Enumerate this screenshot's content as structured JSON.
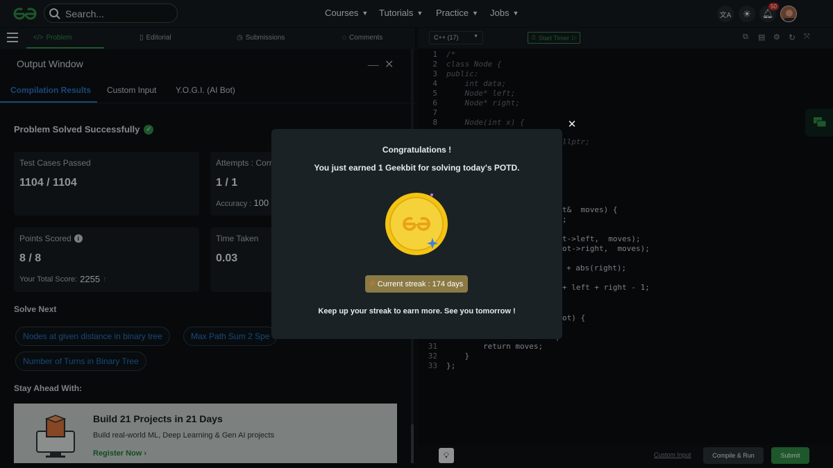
{
  "header": {
    "search_placeholder": "Search...",
    "nav": [
      "Courses",
      "Tutorials",
      "Practice",
      "Jobs"
    ],
    "notification_count": "50"
  },
  "tabs": {
    "problem": "Problem",
    "editorial": "Editorial",
    "submissions": "Submissions",
    "comments": "Comments"
  },
  "output": {
    "title": "Output Window",
    "minimize": "__",
    "tabs": [
      "Compilation Results",
      "Custom Input",
      "Y.O.G.I. (AI Bot)"
    ],
    "solved_message": "Problem Solved Successfully",
    "test_cases_label": "Test Cases Passed",
    "test_cases_value": "1104 / 1104",
    "attempts_label": "Attempts : Corr",
    "attempts_value": "1 / 1",
    "accuracy_label": "Accuracy :",
    "accuracy_value": "100",
    "points_label": "Points Scored",
    "points_value": "8 / 8",
    "total_score_label": "Your Total Score:",
    "total_score_value": "2255",
    "time_label": "Time Taken",
    "time_value": "0.03",
    "solve_next_heading": "Solve Next",
    "solve_next": [
      "Nodes at given distance in binary tree",
      "Max Path Sum 2 Spe",
      "Number of Turns in Binary Tree"
    ],
    "stay_ahead_heading": "Stay Ahead With:",
    "promo_title": "Build 21 Projects in 21 Days",
    "promo_desc": "Build real-world ML, Deep Learning & Gen AI projects",
    "promo_cta": "Register Now"
  },
  "editor": {
    "language": "C++ (17)",
    "timer_label": "Start Timer",
    "lines_top": [
      {
        "n": "1",
        "text": "/*"
      },
      {
        "n": "2",
        "text": "class Node {"
      },
      {
        "n": "3",
        "text": "public:"
      },
      {
        "n": "4",
        "text": "    int data;"
      },
      {
        "n": "5",
        "text": "    Node* left;"
      },
      {
        "n": "6",
        "text": "    Node* right;"
      },
      {
        "n": "7",
        "text": ""
      },
      {
        "n": "8",
        "text": "    Node(int x) {"
      }
    ],
    "partial_lines": [
      "llptr;",
      "t&  moves) {",
      ";",
      "t->left,  moves);",
      "ot->right,  moves);",
      "+ abs(right);",
      "+ left + right - 1;",
      "ot) {",
      ")"
    ],
    "lines_bottom": [
      {
        "n": "31",
        "text": "        return moves;"
      },
      {
        "n": "32",
        "text": "    }"
      },
      {
        "n": "33",
        "text": "};"
      }
    ],
    "custom_input": "Custom Input",
    "compile_run": "Compile & Run",
    "submit": "Submit"
  },
  "modal": {
    "title": "Congratulations !",
    "subtitle": "You just earned 1 Geekbit for solving today's POTD.",
    "streak": "Current streak : 174 days",
    "footer": "Keep up your streak to earn more. See you tomorrow !",
    "close": "✕"
  },
  "colors": {
    "brand_green": "#2f8d46",
    "coin_gold": "#f3c414",
    "link_blue": "#2a73c4"
  }
}
